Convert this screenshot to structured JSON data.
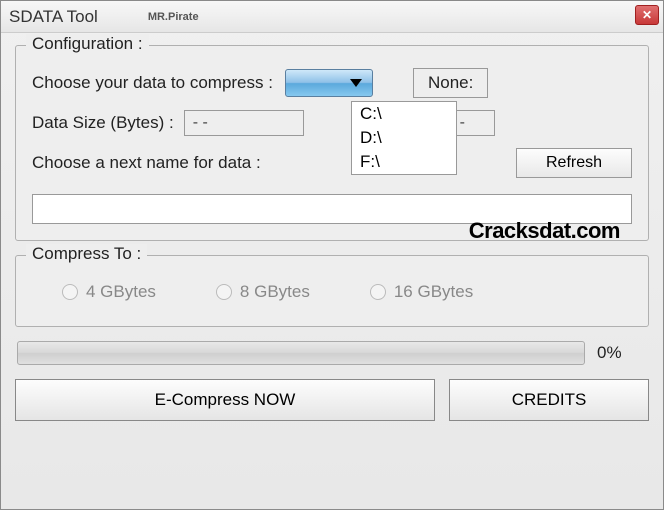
{
  "window": {
    "title": "SDATA Tool",
    "subtitle": "MR.Pirate"
  },
  "config": {
    "legend": "Configuration :",
    "choose_data_label": "Choose your data to compress :",
    "none_label": "None:",
    "drive_options": [
      "C:\\",
      "D:\\",
      "F:\\"
    ],
    "data_size_label": "Data Size (Bytes) :",
    "data_size_value": "- -",
    "paren": ") :",
    "second_value": "- -",
    "choose_name_label": "Choose a next name for data :",
    "refresh_label": "Refresh",
    "name_value": ""
  },
  "watermark": "Cracksdat.com",
  "compress_to": {
    "legend": "Compress To :",
    "options": [
      "4 GBytes",
      "8 GBytes",
      "16 GBytes"
    ]
  },
  "progress": {
    "percent_label": "0%"
  },
  "buttons": {
    "compress": "E-Compress NOW",
    "credits": "CREDITS"
  }
}
